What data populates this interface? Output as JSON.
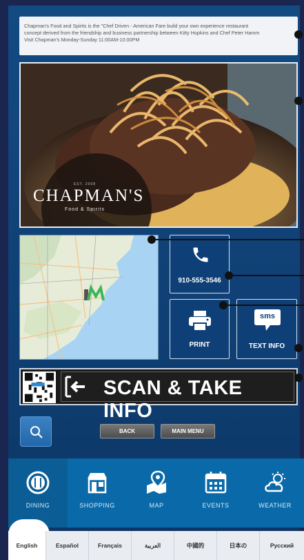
{
  "description": {
    "line1": "Chapman's Food and Spirits is the \"Chef Driven - American Fare build your own experience restaurant",
    "line2": "concept derived from the friendship and business partnership between Kitty Hopkins and Chef Peter Hamm",
    "line3": "Visit Chapman's Monday-Sunday 11:00AM-10:00PM"
  },
  "hero": {
    "logo_est": "EST. 2008",
    "logo_main": "CHAPMAN'S",
    "logo_sub": "Food & Spirits"
  },
  "phone": {
    "number": "910-555-3546",
    "icon": "phone-icon"
  },
  "print": {
    "label": "PRINT",
    "icon": "printer-icon"
  },
  "text_info": {
    "label": "TEXT INFO",
    "badge": "sms",
    "icon": "sms-icon"
  },
  "scan": {
    "label": "SCAN & TAKE INFO"
  },
  "controls": {
    "back": "BACK",
    "main_menu": "MAIN MENU"
  },
  "nav": [
    {
      "label": "DINING",
      "icon": "dining-icon"
    },
    {
      "label": "SHOPPING",
      "icon": "shopping-icon"
    },
    {
      "label": "MAP",
      "icon": "map-icon"
    },
    {
      "label": "EVENTS",
      "icon": "events-icon"
    },
    {
      "label": "WEATHER",
      "icon": "weather-icon"
    }
  ],
  "languages": [
    "English",
    "Español",
    "Français",
    "العربية",
    "中國的",
    "日本の",
    "Русский"
  ],
  "colors": {
    "background": "#0f3f73",
    "nav": "#0a6aa9",
    "accent": "#2f7cc0"
  }
}
